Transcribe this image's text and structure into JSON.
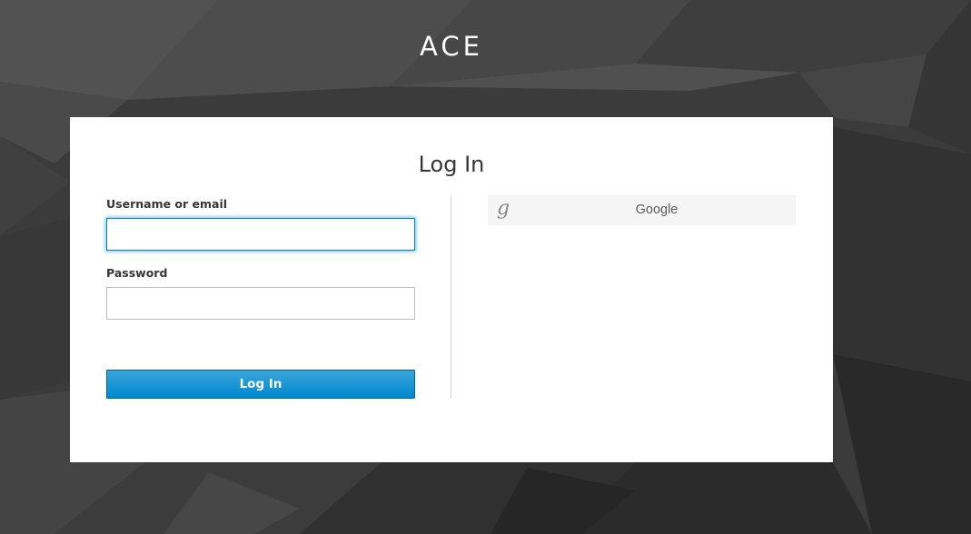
{
  "brand": {
    "name": "ACE"
  },
  "login": {
    "title": "Log In",
    "username_label": "Username or email",
    "username_value": "",
    "password_label": "Password",
    "password_value": "",
    "submit_label": "Log In"
  },
  "social": {
    "providers": [
      {
        "icon": "google-icon",
        "glyph": "g",
        "label": "Google"
      }
    ]
  },
  "colors": {
    "accent": "#0088ce",
    "background": "#3a3a3a",
    "card": "#ffffff",
    "social_button": "#f5f5f5"
  }
}
